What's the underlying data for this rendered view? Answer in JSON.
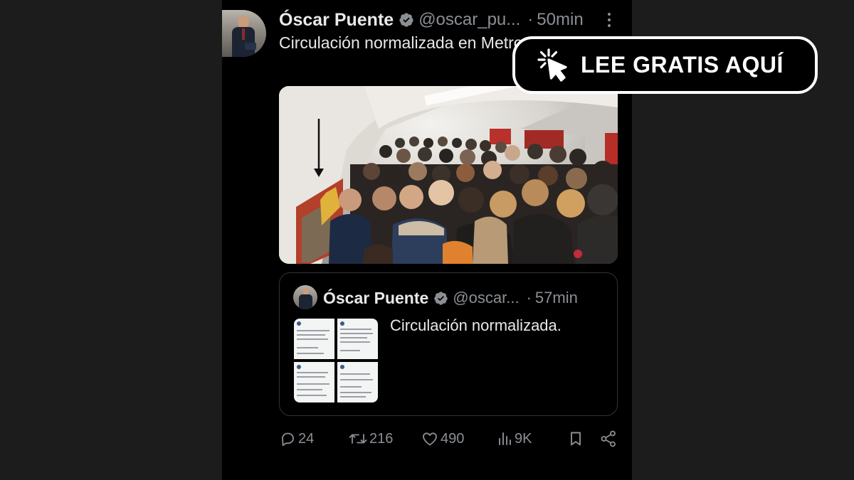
{
  "tweet": {
    "author_name": "Óscar Puente",
    "handle": "@oscar_pu...",
    "separator": "·",
    "time": "50min",
    "text": "Circulación normalizada en Metro de Madrid."
  },
  "quoted_tweet": {
    "author_name": "Óscar Puente",
    "handle": "@oscar...",
    "separator": "·",
    "time": "57min",
    "text": "Circulación normalizada."
  },
  "actions": {
    "replies": "24",
    "retweets": "216",
    "likes": "490",
    "views": "9K"
  },
  "cta": {
    "label": "LEE GRATIS AQUÍ"
  },
  "icons": {
    "verified": "verified-badge-icon",
    "more": "more-dots-icon",
    "reply": "reply-icon",
    "retweet": "retweet-icon",
    "like": "heart-icon",
    "views": "views-chart-icon",
    "bookmark": "bookmark-icon",
    "share": "share-icon",
    "cta": "cursor-click-icon"
  },
  "colors": {
    "background": "#000000",
    "text": "#e7e9ea",
    "muted": "#8b8f94",
    "verified": "#8b8f94",
    "border": "#2f3336"
  }
}
